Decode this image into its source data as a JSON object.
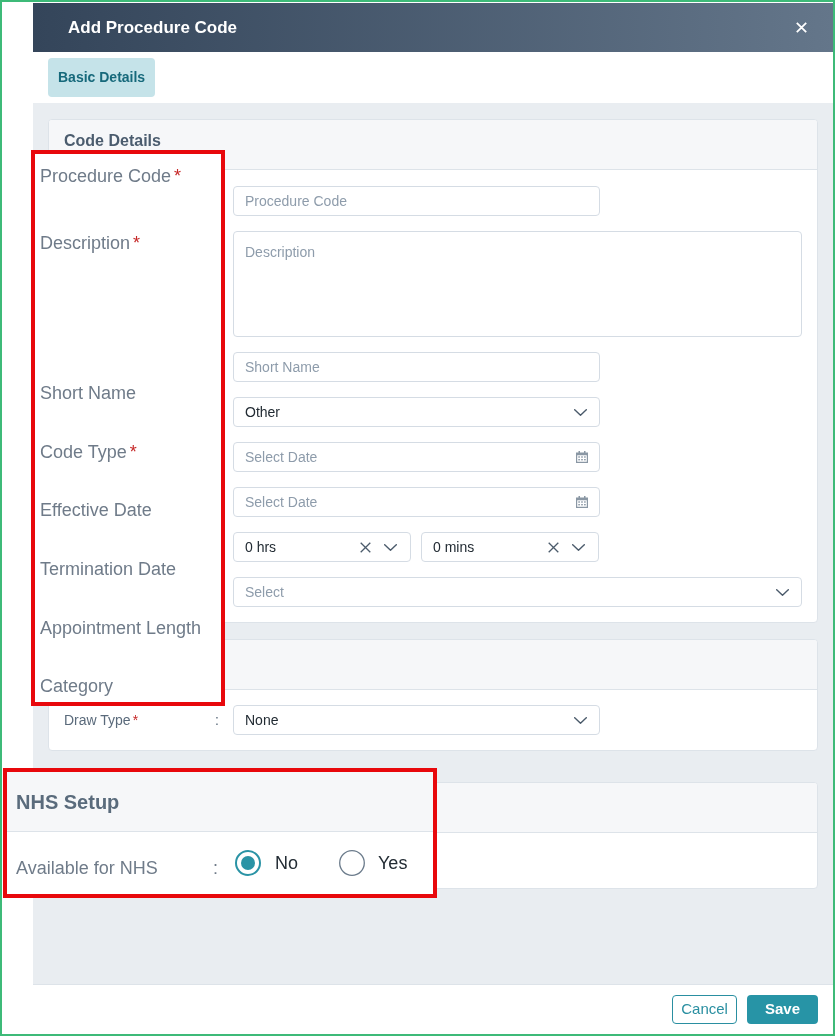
{
  "dialog": {
    "title": "Add Procedure Code"
  },
  "tabs": [
    {
      "label": "Basic Details",
      "selected": true
    }
  ],
  "code_details": {
    "title": "Code Details",
    "fields": [
      {
        "kind": "text",
        "placeholder": "Procedure Code"
      },
      {
        "kind": "textarea",
        "placeholder": "Description"
      },
      {
        "kind": "text",
        "placeholder": "Short Name"
      },
      {
        "kind": "select",
        "value": "Other"
      },
      {
        "kind": "date",
        "placeholder": "Select Date"
      },
      {
        "kind": "date",
        "placeholder": "Select Date"
      },
      {
        "kind": "duration",
        "parts": [
          {
            "value": "0 hrs"
          },
          {
            "value": "0 mins"
          }
        ]
      },
      {
        "kind": "multiselect",
        "placeholder": "Select"
      }
    ]
  },
  "draw_type": {
    "label": "Draw Type",
    "required_mark": "*",
    "separator": ":",
    "value": "None"
  },
  "label_overlay": {
    "labels": [
      {
        "text": "Procedure Code",
        "required_mark": "*"
      },
      {
        "text": "Description",
        "required_mark": "*"
      },
      {
        "text": "Short Name"
      },
      {
        "text": "Code Type",
        "required_mark": "*"
      },
      {
        "text": "Effective Date"
      },
      {
        "text": "Termination Date"
      },
      {
        "text": "Appointment Length"
      },
      {
        "text": "Category"
      }
    ]
  },
  "nhs_overlay": {
    "title": "NHS Setup",
    "label": "Available for NHS",
    "separator": ":",
    "options": [
      {
        "label": "No",
        "selected": true
      },
      {
        "label": "Yes",
        "selected": false
      }
    ]
  },
  "footer": {
    "buttons": [
      {
        "label": "Cancel",
        "kind": "secondary"
      },
      {
        "label": "Save",
        "kind": "primary"
      }
    ]
  }
}
